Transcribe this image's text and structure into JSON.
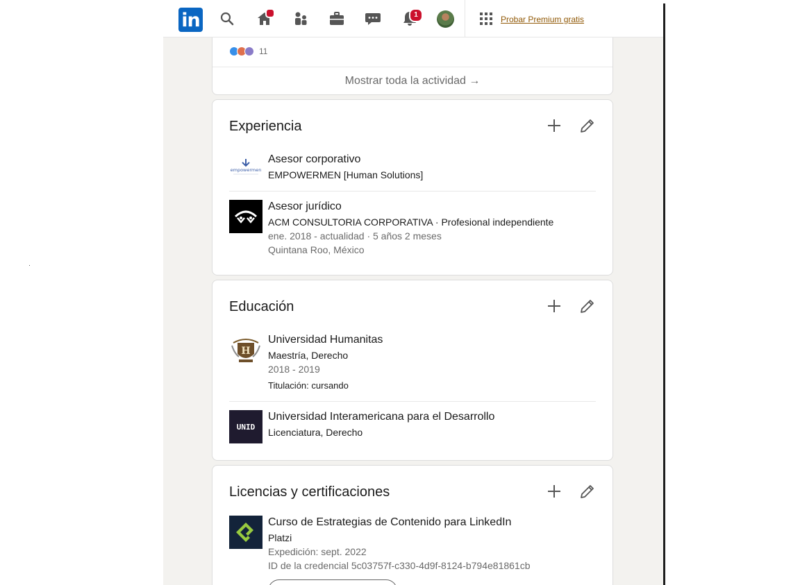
{
  "nav": {
    "logo": "in",
    "home_badge": "",
    "notifications_badge": "1",
    "premium_link": "Probar Premium gratis"
  },
  "activity": {
    "reaction_count": "11",
    "show_all": "Mostrar toda la actividad →"
  },
  "experience": {
    "title": "Experiencia",
    "items": [
      {
        "title": "Asesor corporativo",
        "company": "EMPOWERMEN [Human Solutions]",
        "logo_text": "empowermen"
      },
      {
        "title": "Asesor jurídico",
        "company": "ACM CONSULTORIA CORPORATIVA · Profesional independiente",
        "dates": "ene. 2018 - actualidad · 5 años 2 meses",
        "location": "Quintana Roo, México"
      }
    ]
  },
  "education": {
    "title": "Educación",
    "items": [
      {
        "school": "Universidad Humanitas",
        "degree": "Maestría, Derecho",
        "dates": "2018 - 2019",
        "extra": "Titulación: cursando",
        "logo_text": "H"
      },
      {
        "school": "Universidad Interamericana para el Desarrollo",
        "degree": "Licenciatura, Derecho",
        "logo_text": "UNID"
      }
    ]
  },
  "certifications": {
    "title": "Licencias y certificaciones",
    "items": [
      {
        "name": "Curso de Estrategias de Contenido para LinkedIn",
        "issuer": "Platzi",
        "issued": "Expedición: sept. 2022",
        "credential": "ID de la credencial 5c03757f-c330-4d9f-8124-b794e81861cb"
      }
    ]
  },
  "colors": {
    "linkedin_blue": "#0a66c2",
    "badge_red": "#cb112d",
    "premium_gold": "#915907",
    "feed_bg": "#f3f2ef"
  }
}
